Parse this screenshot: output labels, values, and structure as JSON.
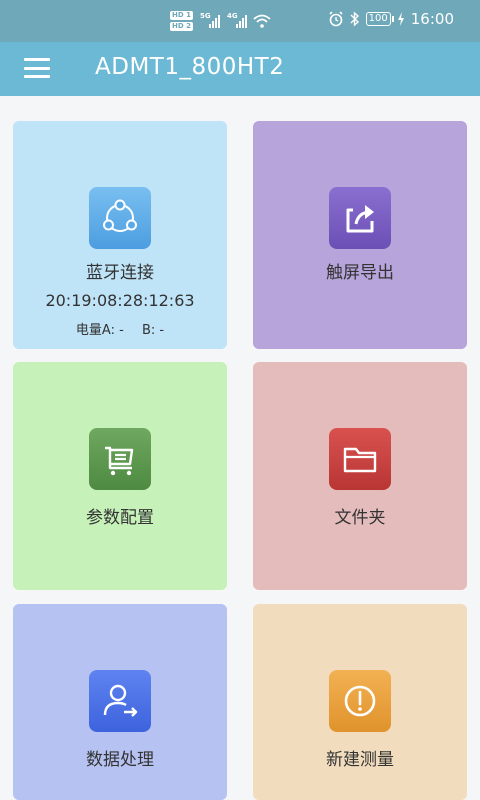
{
  "status_bar": {
    "hd1": "HD 1",
    "hd2": "HD 2",
    "net1": "5G",
    "net2": "4G",
    "battery": "100",
    "time": "16:00"
  },
  "app_bar": {
    "title": "ADMT1_800HT2"
  },
  "tiles": {
    "bluetooth": {
      "label": "蓝牙连接",
      "timestamp": "20:19:08:28:12:63",
      "battery_a": "电量A: -",
      "battery_b": "B: -",
      "color": "#bfe3f7",
      "icon": "share-nodes-icon"
    },
    "export": {
      "label": "触屏导出",
      "color": "#b6a4da",
      "icon": "export-icon"
    },
    "params": {
      "label": "参数配置",
      "color": "#c6f1b8",
      "icon": "cart-icon"
    },
    "folder": {
      "label": "文件夹",
      "color": "#e5bcbc",
      "icon": "folder-icon"
    },
    "data": {
      "label": "数据处理",
      "color": "#b6c2f2",
      "icon": "user-arrow-icon"
    },
    "measure": {
      "label": "新建测量",
      "color": "#f1dcbd",
      "icon": "gauge-icon"
    }
  }
}
